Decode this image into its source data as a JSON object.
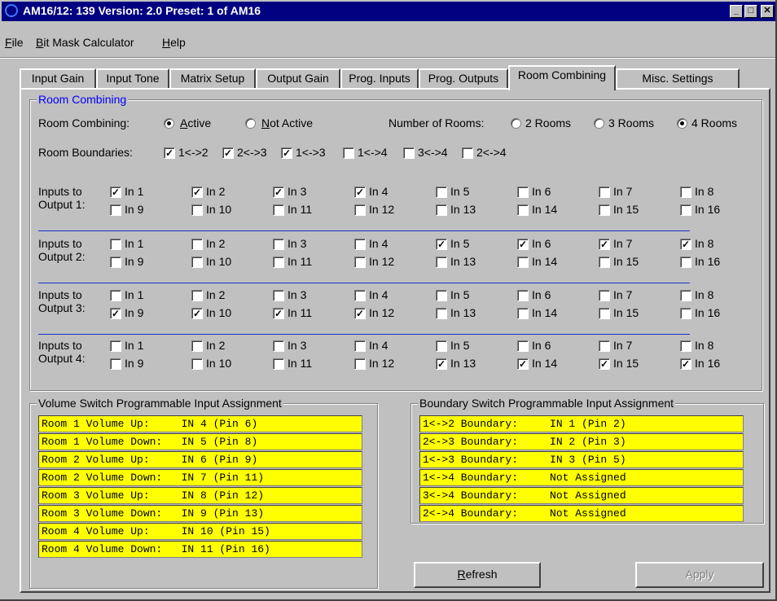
{
  "window": {
    "title": "AM16/12: 139  Version: 2.0  Preset: 1 of AM16",
    "buttons": {
      "minimize": "_",
      "maximize": "□",
      "close": "✕"
    }
  },
  "menu": [
    {
      "label": "File",
      "key": "F",
      "rest": "ile"
    },
    {
      "label": "Bit Mask Calculator",
      "key": "B",
      "rest": "it Mask Calculator"
    },
    {
      "label": "Help",
      "key": "H",
      "rest": "elp"
    }
  ],
  "tabs": [
    "Input Gain",
    "Input Tone",
    "Matrix Setup",
    "Output Gain",
    "Prog. Inputs",
    "Prog. Outputs",
    "Room Combining",
    "Misc. Settings"
  ],
  "active_tab": "Room Combining",
  "room_combining": {
    "group_title": "Room Combining",
    "combining_label": "Room Combining:",
    "active_label": "Active",
    "active_key": "A",
    "active_rest": "ctive",
    "not_active_label": "Not Active",
    "not_active_key": "N",
    "not_active_rest": "ot Active",
    "combining_selected": "Active",
    "num_rooms_label": "Number of Rooms:",
    "rooms_options": [
      "2 Rooms",
      "3 Rooms",
      "4 Rooms"
    ],
    "rooms_selected": "4 Rooms",
    "boundaries_label": "Room Boundaries:",
    "boundaries": [
      {
        "label": "1<->2",
        "checked": true
      },
      {
        "label": "2<->3",
        "checked": true
      },
      {
        "label": "1<->3",
        "checked": true
      },
      {
        "label": "1<->4",
        "checked": false
      },
      {
        "label": "3<->4",
        "checked": false
      },
      {
        "label": "2<->4",
        "checked": false
      }
    ],
    "outputs": [
      {
        "label1": "Inputs to",
        "label2": "Output 1:",
        "checked": [
          1,
          2,
          3,
          4
        ]
      },
      {
        "label1": "Inputs to",
        "label2": "Output 2:",
        "checked": [
          5,
          6,
          7,
          8
        ]
      },
      {
        "label1": "Inputs to",
        "label2": "Output 3:",
        "checked": [
          9,
          10,
          11,
          12
        ]
      },
      {
        "label1": "Inputs to",
        "label2": "Output 4:",
        "checked": [
          13,
          14,
          15,
          16
        ]
      }
    ],
    "input_labels": [
      "In 1",
      "In 2",
      "In 3",
      "In 4",
      "In 5",
      "In 6",
      "In 7",
      "In 8",
      "In 9",
      "In 10",
      "In 11",
      "In 12",
      "In 13",
      "In 14",
      "In 15",
      "In 16"
    ]
  },
  "volume_group": {
    "title": "Volume Switch Programmable Input Assignment",
    "rows": [
      "Room 1 Volume Up:     IN 4 (Pin 6)",
      "Room 1 Volume Down:   IN 5 (Pin 8)",
      "Room 2 Volume Up:     IN 6 (Pin 9)",
      "Room 2 Volume Down:   IN 7 (Pin 11)",
      "Room 3 Volume Up:     IN 8 (Pin 12)",
      "Room 3 Volume Down:   IN 9 (Pin 13)",
      "Room 4 Volume Up:     IN 10 (Pin 15)",
      "Room 4 Volume Down:   IN 11 (Pin 16)"
    ]
  },
  "boundary_group": {
    "title": "Boundary Switch Programmable Input Assignment",
    "rows": [
      "1<->2 Boundary:     IN 1 (Pin 2)",
      "2<->3 Boundary:     IN 2 (Pin 3)",
      "1<->3 Boundary:     IN 3 (Pin 5)",
      "1<->4 Boundary:     Not Assigned",
      "3<->4 Boundary:     Not Assigned",
      "2<->4 Boundary:     Not Assigned"
    ]
  },
  "buttons": {
    "refresh": "Refresh",
    "refresh_key": "R",
    "refresh_rest": "efresh",
    "apply": "Apply",
    "apply_enabled": false
  },
  "colors": {
    "title_bar": "#000080",
    "face": "#c0c0c0",
    "list_bg": "#ffff00",
    "group_title": "#0000ff",
    "separator": "#1a33c8"
  }
}
